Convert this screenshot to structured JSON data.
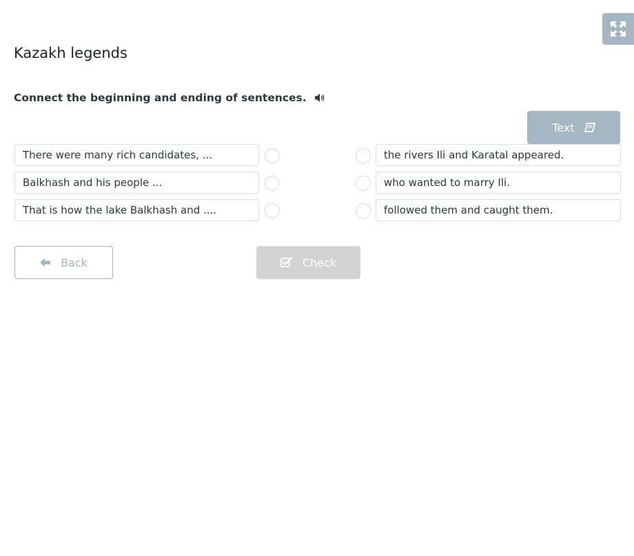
{
  "title": "Kazakh legends",
  "instruction": "Connect the beginning and ending of sentences.",
  "text_button_label": "Text",
  "left_items": [
    "There were many rich candidates, ...",
    "Balkhash and his people ...",
    "That is how the lake Balkhash and ...."
  ],
  "right_items": [
    "the rivers Ili and Karatal appeared.",
    "who wanted to marry Ili.",
    "followed them and caught them."
  ],
  "back_label": "Back",
  "check_label": "Check",
  "colors": {
    "accent": "#a4b6c2",
    "disabled": "#d3d3d3",
    "border": "#d9dde0"
  },
  "icons": {
    "fullscreen": "expand-arrows-icon",
    "audio": "speaker-icon",
    "text": "book-icon",
    "back": "arrow-left-icon",
    "check": "checkbox-check-icon"
  }
}
